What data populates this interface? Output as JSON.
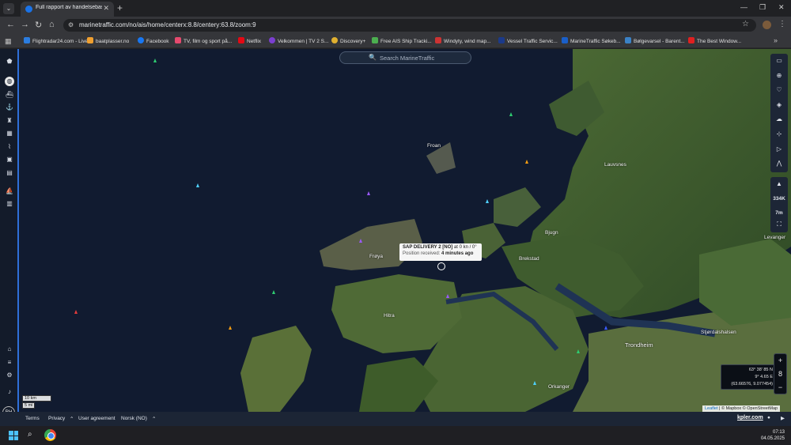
{
  "browser": {
    "tab_title": "Full rapport av handelsebasert...",
    "url": "marinetraffic.com/no/ais/home/centerx:8.8/centery:63.8/zoom:9",
    "bookmarks": [
      "Flightradar24.com - Live...",
      "baatplasser.no",
      "Facebook",
      "TV, film og sport på...",
      "Netflix",
      "Velkommen | TV 2 S...",
      "Discovery+",
      "Free AIS Ship Tracki...",
      "Windyty, wind map...",
      "Vessel Traffic Servic...",
      "MarineTraffic Søkeb...",
      "Bølgevarsel - Barent...",
      "The Best Window..."
    ]
  },
  "map": {
    "search_placeholder": "Search MarineTraffic",
    "places": [
      {
        "name": "Froan"
      },
      {
        "name": "Frøya"
      },
      {
        "name": "Hitra"
      },
      {
        "name": "Bjugn"
      },
      {
        "name": "Brekstad"
      },
      {
        "name": "Trondheim"
      },
      {
        "name": "Orkanger"
      },
      {
        "name": "Levanger"
      },
      {
        "name": "Stjørdalshalsen"
      },
      {
        "name": "Lauvsnes"
      }
    ],
    "tooltip": {
      "vessel": "SAP DELIVERY 2 [NO]",
      "movement": "at 0 kn / 0°",
      "position_label": "Position received:",
      "position_age": "4 minutes ago"
    },
    "side_tools": {
      "count": "334K",
      "wind": "7m"
    },
    "coordinates": {
      "lat": "63° 38' 85 N",
      "lon": "9° 4.65 E",
      "decimal": "(63.66576, 9.077454)"
    },
    "zoom_level": "8",
    "scale": {
      "km": "10 km",
      "mi": "5 mi"
    },
    "attribution": {
      "leaflet": "Leaflet",
      "rest": "| © Mapbox © OpenStreetMap"
    }
  },
  "sidebar": {
    "user_initials": "RH"
  },
  "footer": {
    "terms": "Terms",
    "privacy": "Privacy",
    "user_agreement": "User agreement",
    "language": "Norsk (NO)",
    "brand": "kpler.com"
  },
  "taskbar": {
    "time": "07:13",
    "date": "04.05.2025"
  },
  "colors": {
    "sea": "#111b30",
    "land": "#3d5a2c",
    "sidebar_accent": "#2f6fd8",
    "ship_green": "#2ecc71"
  }
}
